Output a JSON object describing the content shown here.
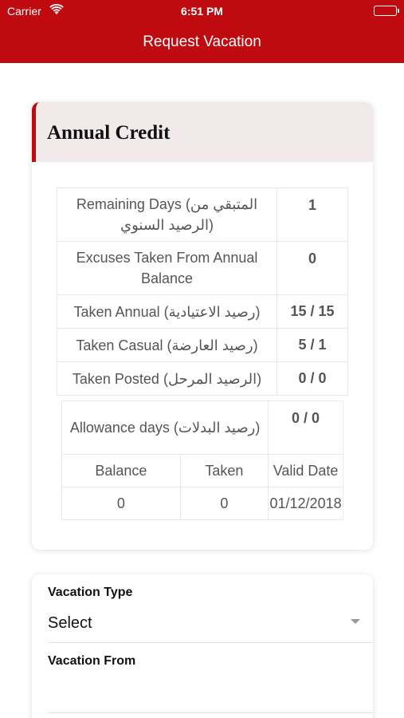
{
  "status_bar": {
    "carrier": "Carrier",
    "time": "6:51 PM"
  },
  "nav": {
    "title": "Request Vacation"
  },
  "annual_credit": {
    "title": "Annual Credit",
    "rows": [
      {
        "label": "Remaining Days (المتبقي من الرصيد السنوي)",
        "value": "1"
      },
      {
        "label": "Excuses Taken From Annual Balance",
        "value": "0"
      },
      {
        "label": "Taken Annual (رصيد الاعتيادية)",
        "value": "15 / 15"
      },
      {
        "label": "Taken Casual (رصيد العارضة)",
        "value": "5 / 1"
      },
      {
        "label": "Taken Posted (الرصيد المرحل)",
        "value": "0 / 0"
      }
    ],
    "allowance": {
      "label": "Allowance days (رصيد البدلات)",
      "value": "0 / 0",
      "columns": [
        "Balance",
        "Taken",
        "Valid Date"
      ],
      "row": [
        "0",
        "0",
        "01/12/2018"
      ]
    }
  },
  "form": {
    "vacation_type_label": "Vacation Type",
    "vacation_type_value": "Select",
    "vacation_from_label": "Vacation From"
  },
  "colors": {
    "brand": "#bf0a0f",
    "header_bg": "#f2e9ea"
  }
}
